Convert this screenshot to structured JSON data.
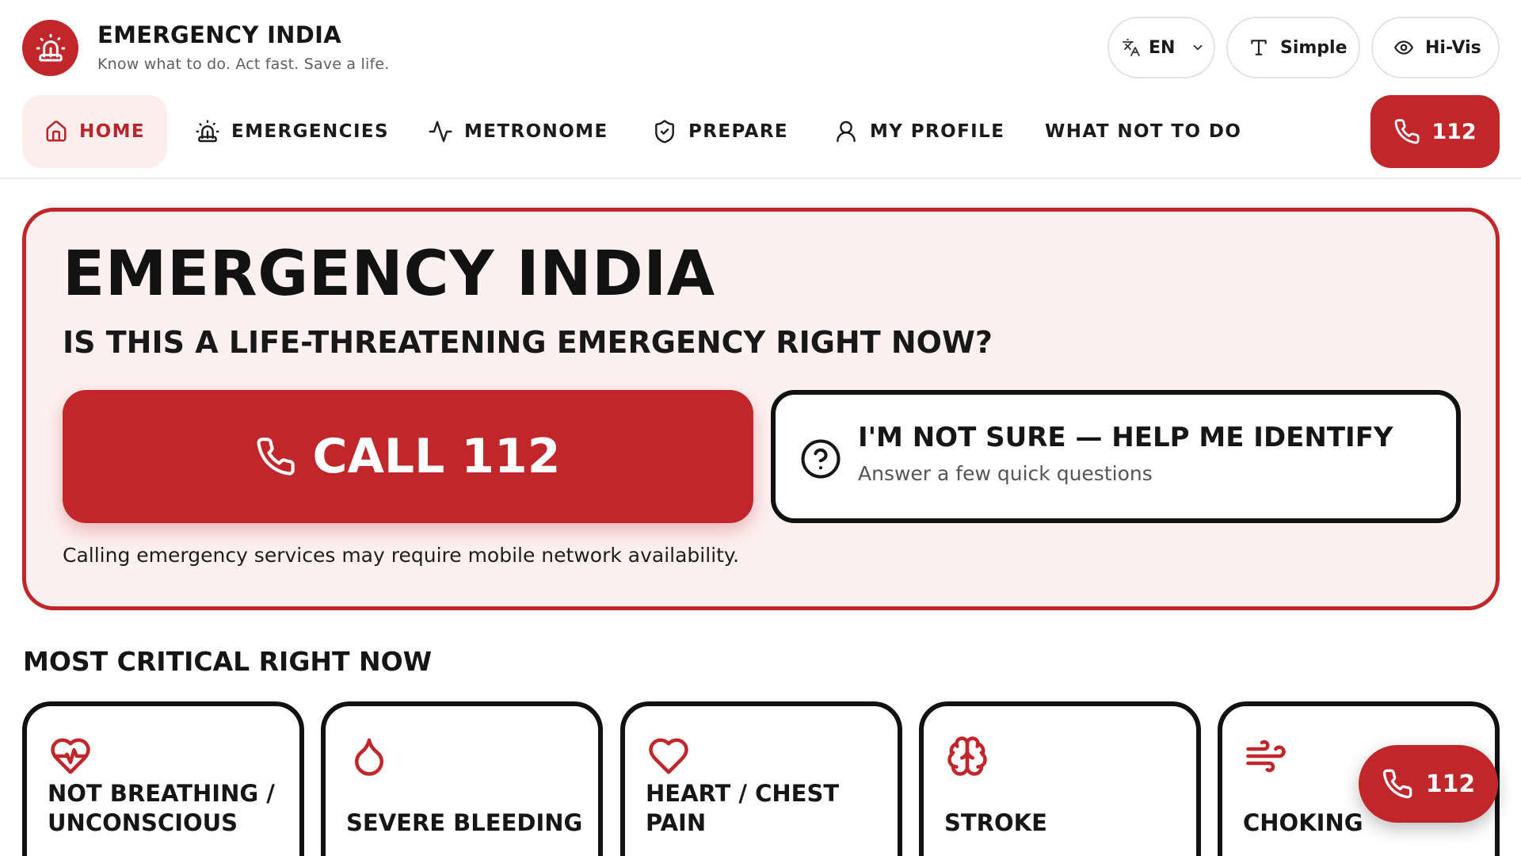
{
  "colors": {
    "accent": "#c0262a",
    "hero_background": "#fdf0f0",
    "home_nav_background": "#fdeeee"
  },
  "brand": {
    "name": "EMERGENCY INDIA",
    "tagline": "Know what to do. Act fast. Save a life.",
    "logo_icon": "siren-icon"
  },
  "header_controls": {
    "language": {
      "label": "EN",
      "icon": "translate-icon"
    },
    "simple": {
      "label": "Simple",
      "icon": "text-type-icon"
    },
    "hivis": {
      "label": "Hi-Vis",
      "icon": "eye-icon"
    }
  },
  "nav": {
    "items": [
      {
        "label": "HOME",
        "icon": "home-icon",
        "active": true
      },
      {
        "label": "EMERGENCIES",
        "icon": "siren-icon"
      },
      {
        "label": "METRONOME",
        "icon": "activity-icon"
      },
      {
        "label": "PREPARE",
        "icon": "shield-check-icon"
      },
      {
        "label": "MY PROFILE",
        "icon": "user-icon"
      },
      {
        "label": "WHAT NOT TO DO"
      }
    ],
    "call_label": "112"
  },
  "hero": {
    "title": "EMERGENCY INDIA",
    "question": "IS THIS A LIFE-THREATENING EMERGENCY RIGHT NOW?",
    "call_label": "CALL 112",
    "not_sure_title": "I'M NOT SURE — HELP ME IDENTIFY",
    "not_sure_subtitle": "Answer a few quick questions",
    "note": "Calling emergency services may require mobile network availability."
  },
  "critical": {
    "title": "MOST CRITICAL RIGHT NOW",
    "cards": [
      {
        "label": "NOT BREATHING /\nUNCONSCIOUS",
        "icon": "heart-pulse-icon"
      },
      {
        "label": "SEVERE BLEEDING",
        "icon": "droplet-icon"
      },
      {
        "label": "HEART / CHEST\nPAIN",
        "icon": "heart-icon"
      },
      {
        "label": "STROKE",
        "icon": "brain-icon"
      },
      {
        "label": "CHOKING",
        "icon": "wind-icon"
      }
    ]
  },
  "floating_call": {
    "label": "112"
  }
}
